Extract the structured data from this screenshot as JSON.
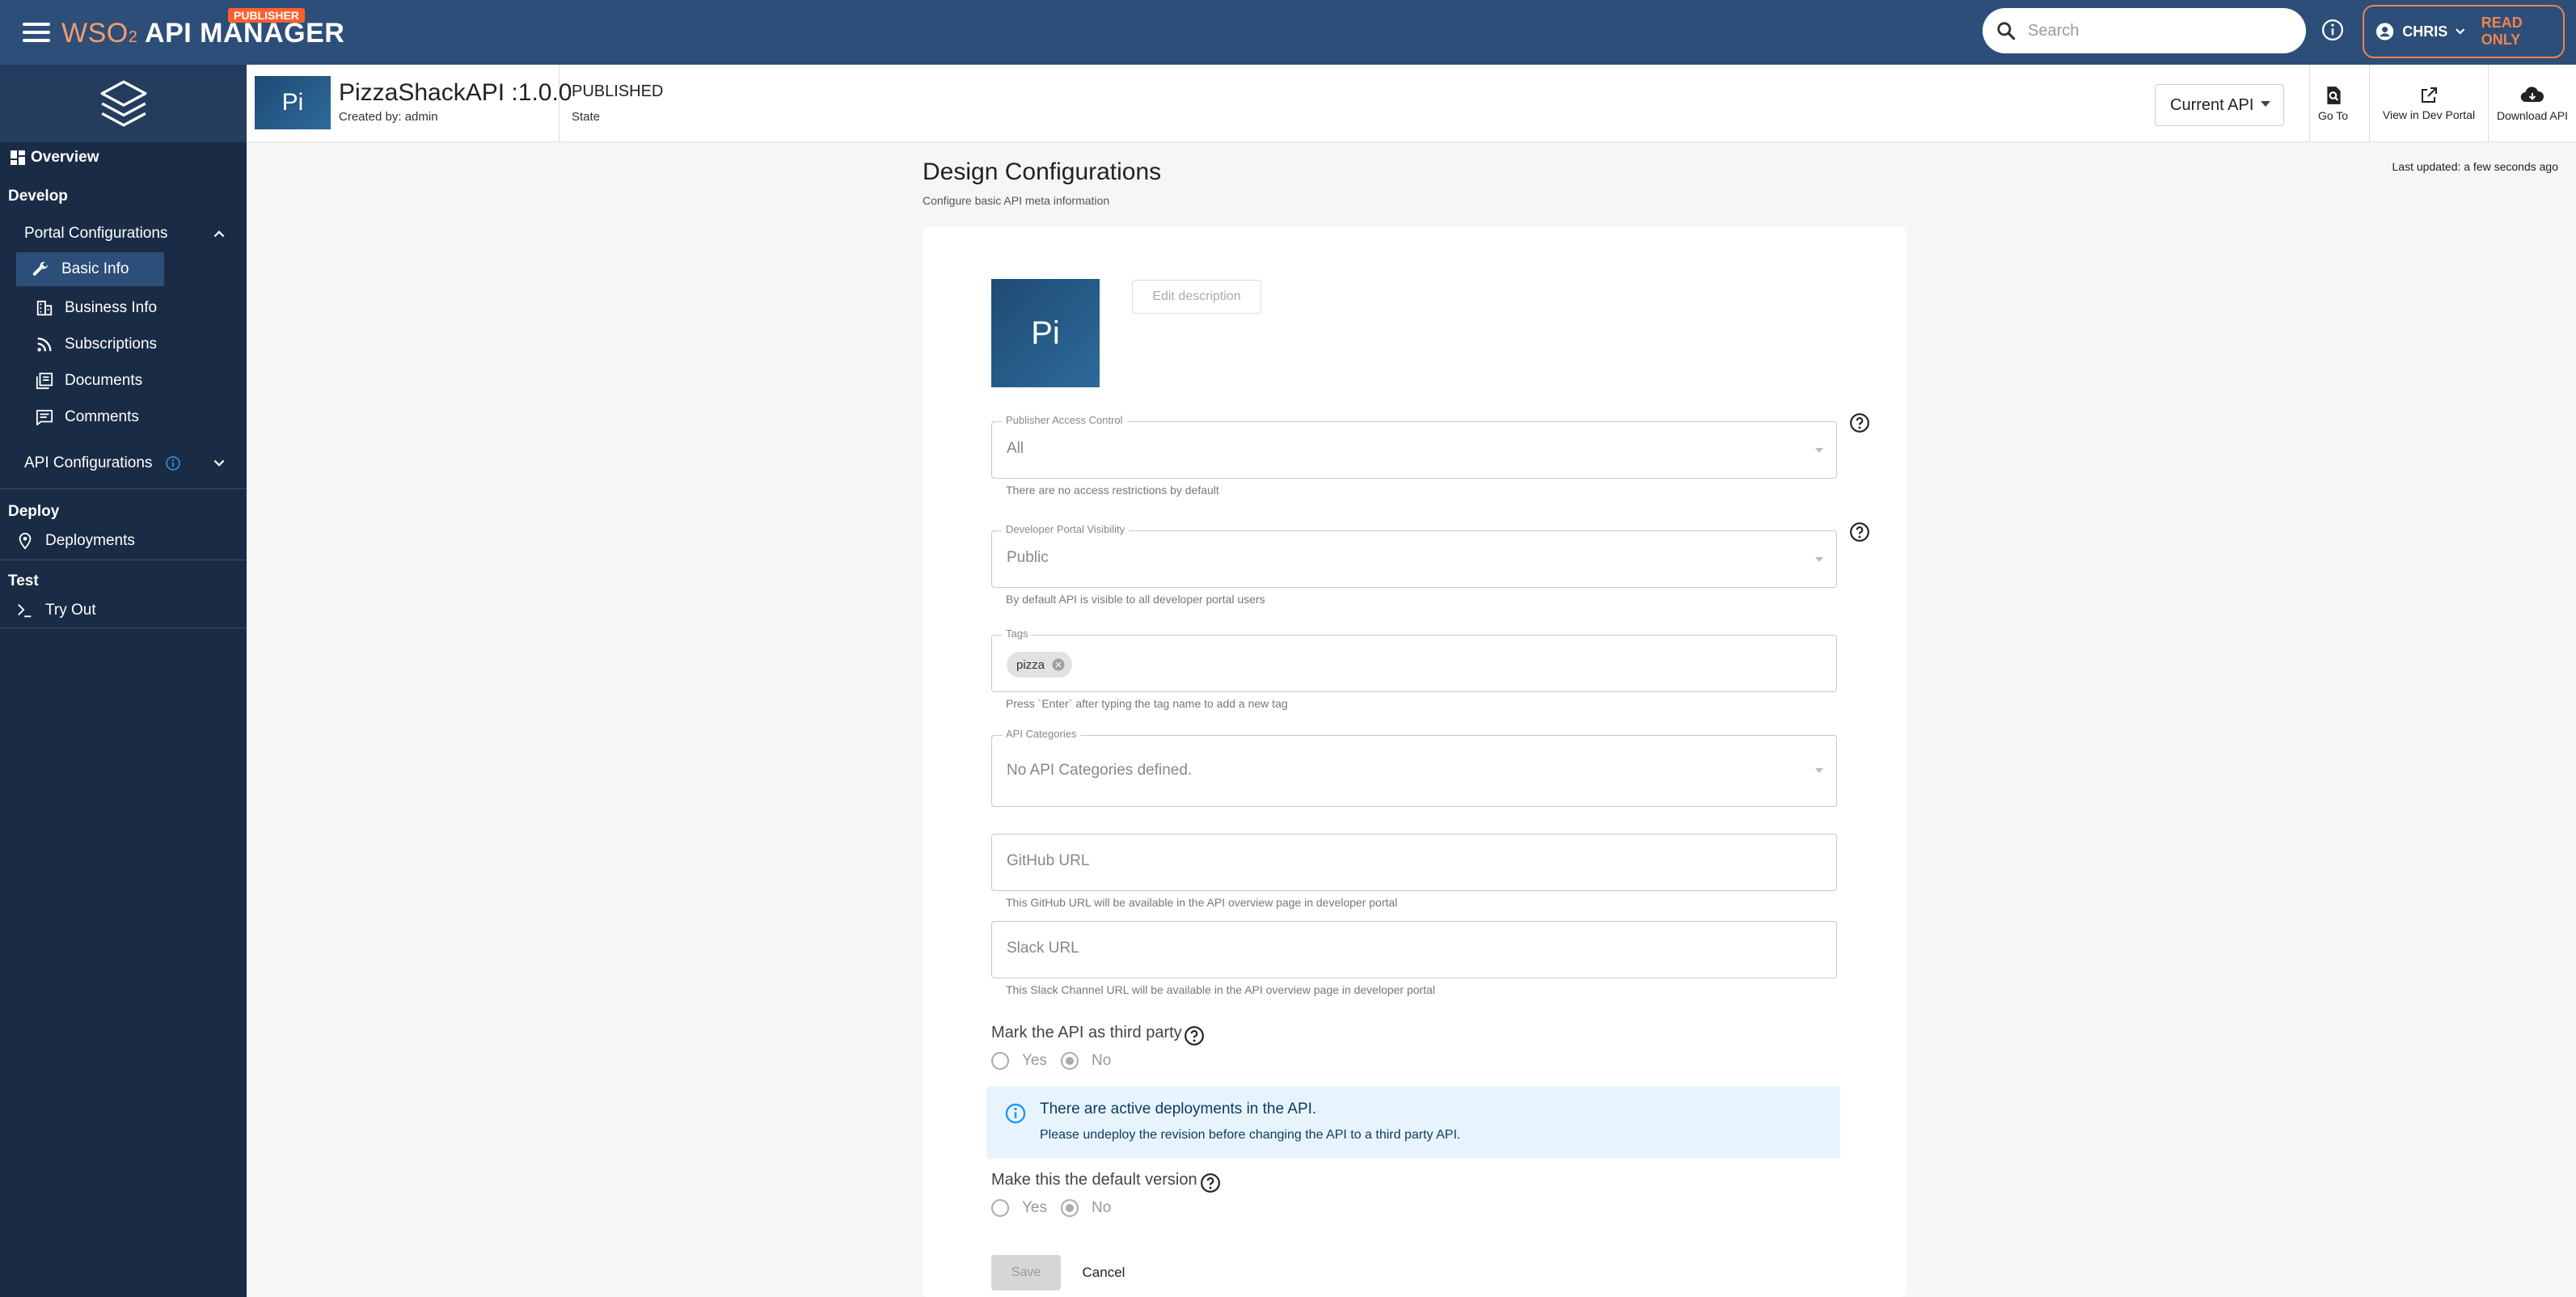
{
  "app": {
    "brand_prefix": "WSO",
    "brand_suffix": "2",
    "brand_name": "API MANAGER",
    "badge": "PUBLISHER",
    "search_placeholder": "Search",
    "user": "CHRIS",
    "read_only": "READ ONLY",
    "accent": "#2d4e79",
    "sidebar_bg": "#1a2b45",
    "highlight": "#f0834d"
  },
  "sidebar": {
    "overview": "Overview",
    "develop": "Develop",
    "portal_configurations": "Portal Configurations",
    "basic_info": "Basic Info",
    "business_info": "Business Info",
    "subscriptions": "Subscriptions",
    "documents": "Documents",
    "comments": "Comments",
    "api_configurations": "API Configurations",
    "deploy": "Deploy",
    "deployments": "Deployments",
    "test": "Test",
    "try_out": "Try Out"
  },
  "api_header": {
    "thumb": "Pi",
    "title": "PizzaShackAPI :1.0.0",
    "created_by": "Created by: admin",
    "state": "PUBLISHED",
    "state_label": "State",
    "current_api": "Current API",
    "go_to": "Go To",
    "view_dev_portal": "View in Dev Portal",
    "download_api": "Download API"
  },
  "main": {
    "title": "Design Configurations",
    "subtitle": "Configure basic API meta information",
    "last_updated": "Last updated: a few seconds ago",
    "thumb": "Pi",
    "edit_description": "Edit description",
    "publisher_access": {
      "legend": "Publisher Access Control",
      "value": "All",
      "helper": "There are no access restrictions by default"
    },
    "dev_portal_visibility": {
      "legend": "Developer Portal Visibility",
      "value": "Public",
      "helper": "By default API is visible to all developer portal users"
    },
    "tags": {
      "legend": "Tags",
      "chips": [
        "pizza"
      ],
      "helper": "Press `Enter` after typing the tag name to add a new tag"
    },
    "api_categories": {
      "legend": "API Categories",
      "value": "No API Categories defined."
    },
    "github": {
      "placeholder": "GitHub URL",
      "helper": "This GitHub URL will be available in the API overview page in developer portal"
    },
    "slack": {
      "placeholder": "Slack URL",
      "helper": "This Slack Channel URL will be available in the API overview page in developer portal"
    },
    "third_party": {
      "question": "Mark the API as third party",
      "yes": "Yes",
      "no": "No",
      "selected": "No"
    },
    "alert": {
      "title": "There are active deployments in the API.",
      "body": "Please undeploy the revision before changing the API to a third party API."
    },
    "default_version": {
      "question": "Make this the default version",
      "yes": "Yes",
      "no": "No",
      "selected": "No"
    },
    "save": "Save",
    "cancel": "Cancel"
  }
}
